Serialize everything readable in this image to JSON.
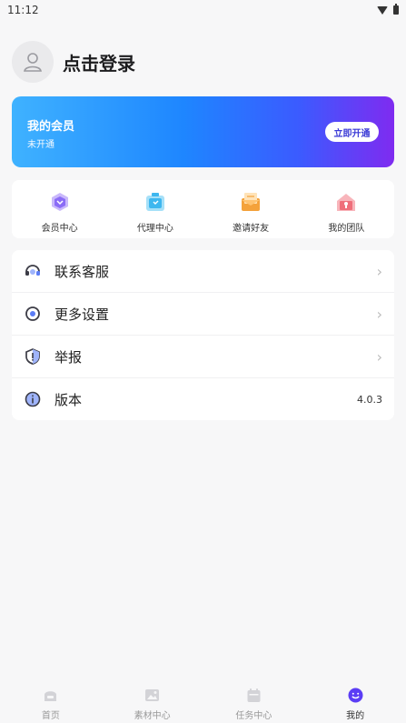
{
  "status_bar": {
    "time": "11:12"
  },
  "profile": {
    "login_text": "点击登录"
  },
  "member": {
    "title": "我的会员",
    "status": "未开通",
    "open_button": "立即开通",
    "gradient": [
      "#3fb2ff",
      "#1e86ff",
      "#3b5bff",
      "#7f2bf0"
    ]
  },
  "quick_actions": [
    {
      "label": "会员中心",
      "icon": "member-center-icon",
      "color": "#8b6cf6"
    },
    {
      "label": "代理中心",
      "icon": "agent-center-icon",
      "color": "#3eb7ef"
    },
    {
      "label": "邀请好友",
      "icon": "invite-friends-icon",
      "color": "#f4a23b"
    },
    {
      "label": "我的团队",
      "icon": "my-team-icon",
      "color": "#ef6f7a"
    }
  ],
  "menu": [
    {
      "label": "联系客服",
      "icon": "headset-icon",
      "trailing": "chevron"
    },
    {
      "label": "更多设置",
      "icon": "settings-icon",
      "trailing": "chevron"
    },
    {
      "label": "举报",
      "icon": "report-shield-icon",
      "trailing": "chevron"
    },
    {
      "label": "版本",
      "icon": "info-icon",
      "trailing": "value",
      "value": "4.0.3"
    }
  ],
  "bottom_nav": [
    {
      "label": "首页",
      "icon": "home-icon",
      "active": false
    },
    {
      "label": "素材中心",
      "icon": "image-icon",
      "active": false
    },
    {
      "label": "任务中心",
      "icon": "calendar-icon",
      "active": false
    },
    {
      "label": "我的",
      "icon": "smile-icon",
      "active": true
    }
  ],
  "colors": {
    "accent": "#5b3df5",
    "background": "#f7f7f8"
  }
}
